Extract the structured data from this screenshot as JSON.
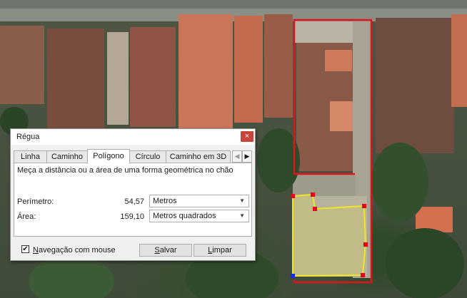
{
  "dialog": {
    "title": "Régua",
    "close_glyph": "×",
    "tabs": [
      {
        "label": "Linha",
        "active": false
      },
      {
        "label": "Caminho",
        "active": false
      },
      {
        "label": "Polígono",
        "active": true
      },
      {
        "label": "Círculo",
        "active": false
      },
      {
        "label": "Caminho em 3D",
        "active": false
      }
    ],
    "tab_scroll": {
      "left_icon": "chevron-left-icon",
      "right_icon": "chevron-right-icon",
      "left_glyph": "◀",
      "right_glyph": "▶"
    },
    "description": "Meça a distância ou a área de uma forma geométrica no chão",
    "perimeter": {
      "label": "Perímetro:",
      "value": "54,57",
      "unit": "Metros"
    },
    "area": {
      "label": "Área:",
      "value": "159,10",
      "unit": "Metros quadrados"
    },
    "mouse_nav": {
      "label": "Navegação com mouse",
      "checked": true
    },
    "buttons": {
      "save_first": "S",
      "save_rest": "alvar",
      "clear_first": "L",
      "clear_rest": "impar"
    }
  },
  "map": {
    "colors": {
      "red_outline": "#e0141c",
      "yellow_polygon": "#f2e526",
      "vertex_red": "#e8001a",
      "vertex_blue": "#1a2ce8"
    }
  }
}
